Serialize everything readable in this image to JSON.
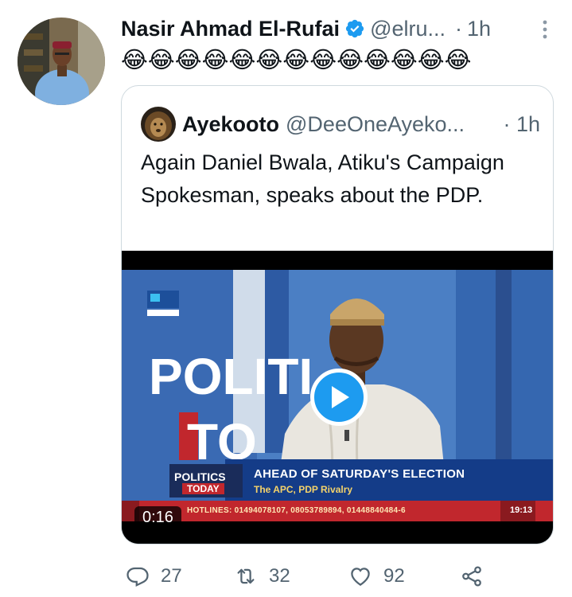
{
  "tweet": {
    "author_name": "Nasir Ahmad El-Rufai",
    "handle": "@elru...",
    "separator": "·",
    "time": "1h",
    "emojis": "😂😂😂😂😂😂😂😂😂😂😂😂😂",
    "verified_color": "#1d9bf0"
  },
  "quoted": {
    "author_name": "Ayekooto",
    "handle": "@DeeOneAyeko...",
    "time": "· 1h",
    "text": "Again Daniel Bwala, Atiku's Campaign Spokesman, speaks about the PDP.",
    "video": {
      "duration": "0:16",
      "ticker_title": "AHEAD OF SATURDAY'S ELECTION",
      "ticker_subtitle": "The APC, PDP Rivalry",
      "show_label_1": "POLITICS",
      "show_label_2": "TODAY",
      "hotlines": "HOTLINES: 01494078107, 08053789894, 01448840484-6",
      "clock": "19:13",
      "background_title": "POLITI",
      "background_title_2": "TO"
    }
  },
  "actions": {
    "replies": "27",
    "retweets": "32",
    "likes": "92"
  },
  "colors": {
    "accent": "#1d9bf0",
    "muted": "#536471",
    "border": "#cfd9de"
  }
}
